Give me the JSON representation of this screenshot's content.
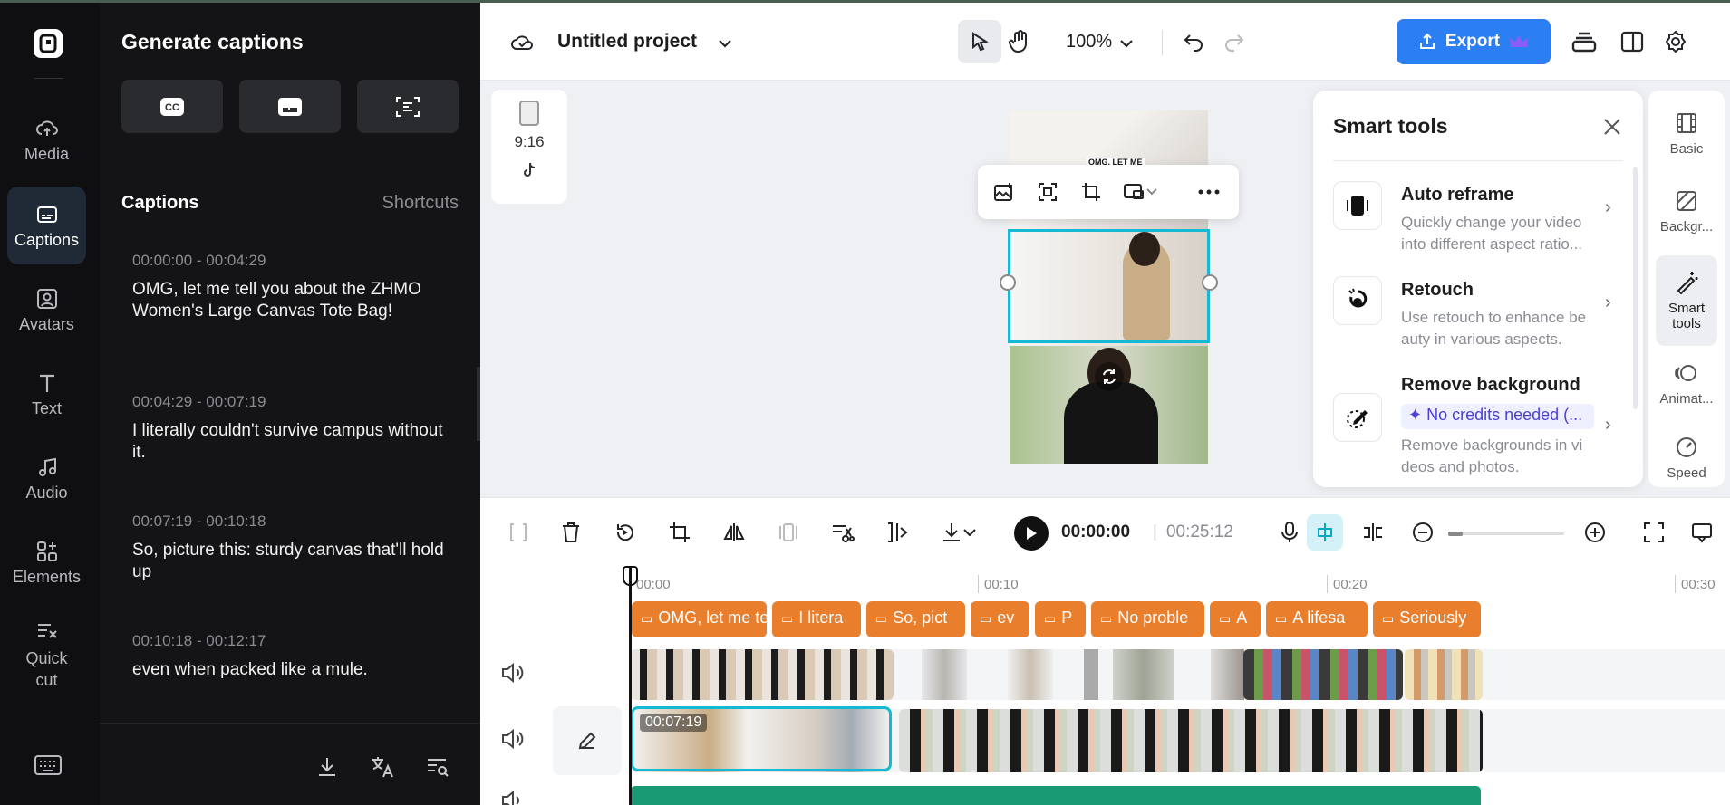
{
  "rail": {
    "items": [
      {
        "label": "Media",
        "icon": "cloud-upload-icon"
      },
      {
        "label": "Captions",
        "icon": "captions-icon",
        "active": true
      },
      {
        "label": "Avatars",
        "icon": "avatar-icon"
      },
      {
        "label": "Text",
        "icon": "text-icon"
      },
      {
        "label": "Audio",
        "icon": "music-note-icon"
      },
      {
        "label": "Elements",
        "icon": "elements-icon"
      },
      {
        "label": "Quick cut",
        "icon": "quick-cut-icon"
      }
    ]
  },
  "captions_panel": {
    "title": "Generate captions",
    "subtitle": "Captions",
    "shortcuts_label": "Shortcuts",
    "entries": [
      {
        "time": "00:00:00 - 00:04:29",
        "text": "OMG, let me tell you about the ZHMO Women's Large Canvas Tote Bag!"
      },
      {
        "time": "00:04:29 - 00:07:19",
        "text": "I literally couldn't survive campus without it."
      },
      {
        "time": "00:07:19 - 00:10:18",
        "text": "So, picture this: sturdy canvas that'll hold up"
      },
      {
        "time": "00:10:18 - 00:12:17",
        "text": "even when packed like a mule."
      }
    ]
  },
  "topbar": {
    "project_title": "Untitled project",
    "zoom": "100%",
    "export_label": "Export"
  },
  "canvas": {
    "ratio_label": "9:16",
    "video_caption": "OMG, LET ME"
  },
  "smart_tools": {
    "title": "Smart tools",
    "items": [
      {
        "name": "Auto reframe",
        "desc": "Quickly change your video into different aspect ratio..."
      },
      {
        "name": "Retouch",
        "desc": "Use retouch to enhance be auty in various aspects."
      },
      {
        "name": "Remove background",
        "badge": "✦ No credits needed (...",
        "desc": "Remove backgrounds in vi deos and photos."
      }
    ]
  },
  "right_rail": {
    "items": [
      {
        "label": "Basic"
      },
      {
        "label": "Backgr..."
      },
      {
        "label": "Smart tools",
        "active": true
      },
      {
        "label": "Animat..."
      },
      {
        "label": "Speed"
      }
    ]
  },
  "timeline_bar": {
    "current_time": "00:00:00",
    "total_time": "00:25:12",
    "separator": "|"
  },
  "timeline": {
    "ruler": [
      "00:00",
      "00:10",
      "00:20",
      "00:30"
    ],
    "caption_clips": [
      "OMG, let me tell",
      "I litera",
      "So, pict",
      "ev",
      "P",
      "No proble",
      "A",
      "A lifesa",
      "Seriously"
    ],
    "main_clip_time": "00:07:19"
  },
  "colors": {
    "accent": "#2b7ff2",
    "caption_clip": "#e97e2c",
    "selection": "#16b9d3",
    "audio_track": "#1a9a73"
  }
}
